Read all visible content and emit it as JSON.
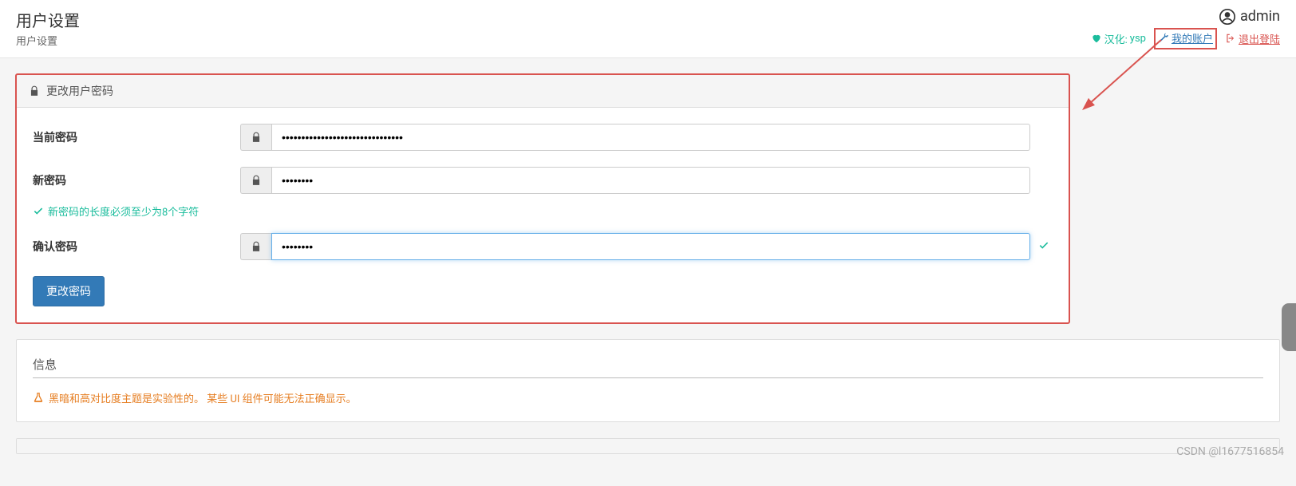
{
  "header": {
    "title": "用户设置",
    "subtitle": "用户设置",
    "username": "admin",
    "links": {
      "localization_label": "汉化:",
      "localization_value": "ysp",
      "my_account": "我的账户",
      "logout": "退出登陆"
    }
  },
  "password_panel": {
    "heading": "更改用户密码",
    "current_label": "当前密码",
    "current_value": "•••••••••••••••••••••••••••••••",
    "new_label": "新密码",
    "new_value": "••••••••",
    "hint": "新密码的长度必须至少为8个字符",
    "confirm_label": "确认密码",
    "confirm_value": "••••••••",
    "submit_label": "更改密码"
  },
  "info_section": {
    "title": "信息",
    "experimental_warning": "黑暗和高对比度主题是实验性的。 某些 UI 组件可能无法正确显示。"
  },
  "watermark": "CSDN @l1677516854"
}
